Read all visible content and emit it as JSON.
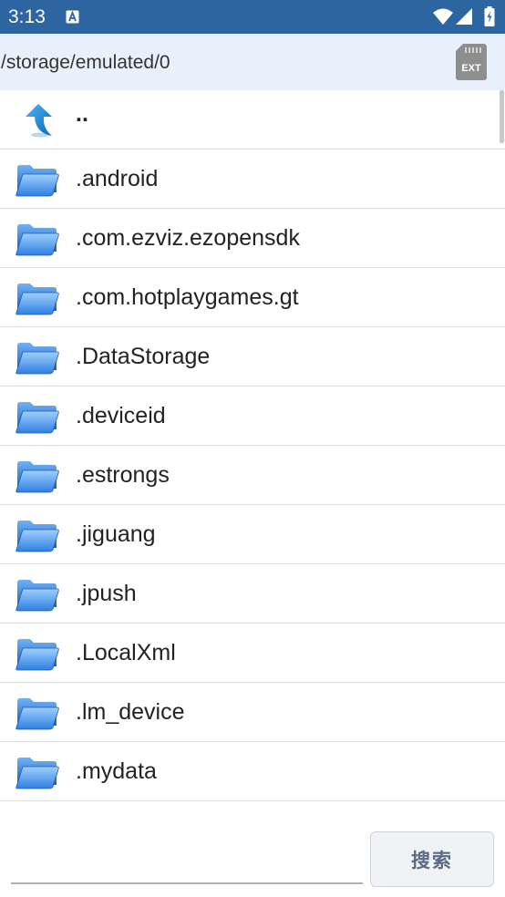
{
  "status_bar": {
    "time": "3:13",
    "icons": [
      "a-notification-icon",
      "wifi-icon",
      "signal-icon",
      "battery-icon"
    ]
  },
  "path_bar": {
    "path": "/storage/emulated/0",
    "ext_label": "EXT"
  },
  "file_list": {
    "up_label": "..",
    "folders": [
      ".android",
      ".com.ezviz.ezopensdk",
      ".com.hotplaygames.gt",
      ".DataStorage",
      ".deviceid",
      ".estrongs",
      ".jiguang",
      ".jpush",
      ".LocalXml",
      ".lm_device",
      ".mydata"
    ]
  },
  "bottom_bar": {
    "search_value": "",
    "search_button_label": "搜索"
  },
  "colors": {
    "status_bar": "#2d65a0",
    "path_bar": "#e8f0fb",
    "folder_blue": "#2f7fe0"
  }
}
